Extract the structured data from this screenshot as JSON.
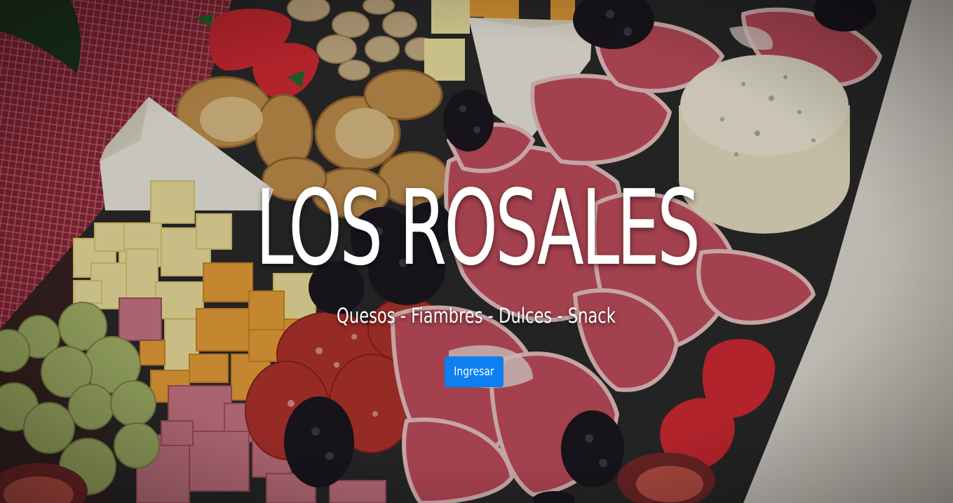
{
  "hero": {
    "title": "LOS ROSALES",
    "subtitle": "Quesos - Fiambres - Dulces - Snack",
    "button_label": "Ingresar",
    "button_color": "#0d7ff0"
  },
  "background": {
    "description_icon": "charcuterie-board-photo",
    "colors": {
      "tablecloth": "#e9e4dc",
      "slate": "#2b2b2d",
      "ham": "#c85060",
      "cheese": "#f1dd8a",
      "cheddar": "#f0a53a",
      "brie": "#f4f1e6",
      "blackberry": "#1b1820",
      "grape": "#a9b96c",
      "strawberry": "#d92b35",
      "bread": "#c9944f",
      "pistachio": "#cfb58a",
      "mesh": "#b24050"
    }
  }
}
